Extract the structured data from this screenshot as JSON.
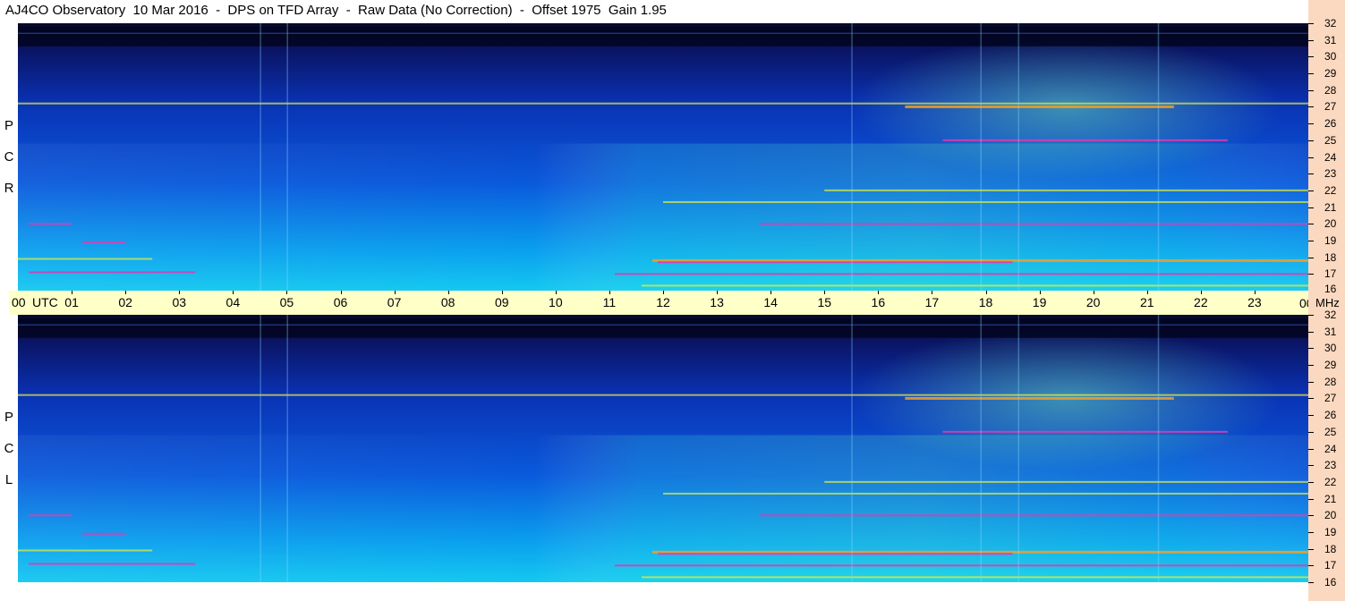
{
  "title": "AJ4CO Observatory  10 Mar 2016  -  DPS on TFD Array  -  Raw Data (No Correction)  -  Offset 1975  Gain 1.95",
  "panels": [
    {
      "id": "rcp",
      "letters": [
        "P",
        "C",
        "R"
      ]
    },
    {
      "id": "lcp",
      "letters": [
        "P",
        "C",
        "L"
      ]
    }
  ],
  "time_axis": {
    "first_label": "00",
    "unit_label": "UTC",
    "ticks": [
      "01",
      "02",
      "03",
      "04",
      "05",
      "06",
      "07",
      "08",
      "09",
      "10",
      "11",
      "12",
      "13",
      "14",
      "15",
      "16",
      "17",
      "18",
      "19",
      "20",
      "21",
      "22",
      "23"
    ],
    "end_label": "00"
  },
  "freq_axis": {
    "unit_label": "MHz",
    "ticks": [
      "32",
      "31",
      "30",
      "29",
      "28",
      "27",
      "26",
      "25",
      "24",
      "23",
      "22",
      "21",
      "20",
      "19",
      "18",
      "17",
      "16"
    ]
  },
  "colors": {
    "background_low": "#0a0f5a",
    "background_mid": "#0a3cd2",
    "background_high": "#14c8f0",
    "rfi_yellow": "#e6f03c",
    "rfi_orange": "#f0a028",
    "rfi_magenta": "#dc3cb4",
    "time_band": "#ffffc8",
    "freq_band": "#fbd9c0"
  },
  "chart_data": {
    "type": "heatmap",
    "title": "AJ4CO Observatory  10 Mar 2016  -  DPS on TFD Array  -  Raw Data (No Correction)  -  Offset 1975  Gain 1.95",
    "x_label": "UTC",
    "y_label": "MHz",
    "x_range_utc_hours": [
      0,
      24
    ],
    "y_range_mhz": [
      16,
      32
    ],
    "series": [
      {
        "name": "RCP"
      },
      {
        "name": "LCP"
      }
    ],
    "rfi_bands_mhz": [
      {
        "f": 31.4,
        "t0": 0,
        "t1": 24,
        "level": "faint"
      },
      {
        "f": 27.0,
        "t0": 16.5,
        "t1": 21.5,
        "level": "strong"
      },
      {
        "f": 27.2,
        "t0": 0,
        "t1": 24,
        "level": "medium"
      },
      {
        "f": 25.0,
        "t0": 17.2,
        "t1": 22.5,
        "level": "magenta"
      },
      {
        "f": 22.0,
        "t0": 15,
        "t1": 24,
        "level": "medium"
      },
      {
        "f": 21.3,
        "t0": 12,
        "t1": 24,
        "level": "medium"
      },
      {
        "f": 20.0,
        "t0": 0.2,
        "t1": 1.0,
        "level": "magenta"
      },
      {
        "f": 20.0,
        "t0": 13.8,
        "t1": 24,
        "level": "magenta"
      },
      {
        "f": 18.9,
        "t0": 1.2,
        "t1": 2.0,
        "level": "magenta"
      },
      {
        "f": 17.9,
        "t0": 0,
        "t1": 2.5,
        "level": "medium"
      },
      {
        "f": 17.8,
        "t0": 11.8,
        "t1": 24,
        "level": "strong"
      },
      {
        "f": 17.7,
        "t0": 11.9,
        "t1": 18.5,
        "level": "magenta"
      },
      {
        "f": 17.1,
        "t0": 0.2,
        "t1": 3.3,
        "level": "magenta"
      },
      {
        "f": 17.0,
        "t0": 11.1,
        "t1": 24,
        "level": "magenta"
      },
      {
        "f": 16.3,
        "t0": 11.6,
        "t1": 24,
        "level": "medium"
      }
    ],
    "vertical_streaks_utc": [
      4.5,
      5.0,
      15.5,
      17.9,
      18.6,
      21.2
    ]
  }
}
